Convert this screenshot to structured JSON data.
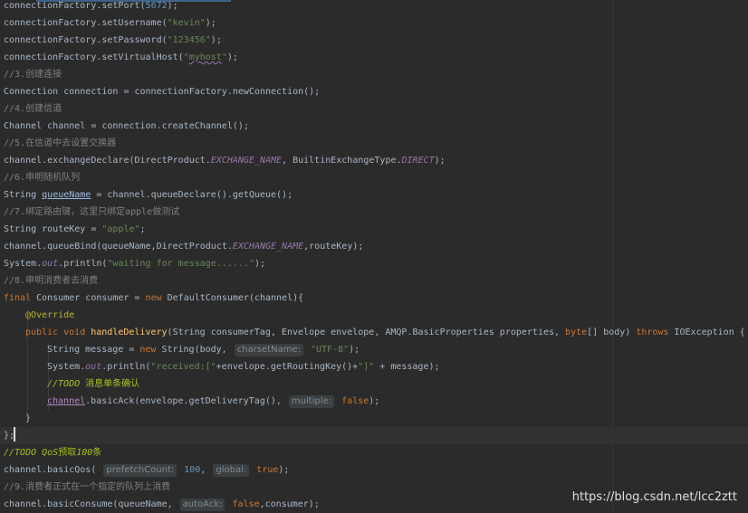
{
  "code": {
    "l1": {
      "a": "connectionFactory.setPort(",
      "n": "5672",
      "b": ");"
    },
    "l2": {
      "a": "connectionFactory.setUsername(",
      "s": "\"kevin\"",
      "b": ");"
    },
    "l3": {
      "a": "connectionFactory.setPassword(",
      "s": "\"123456\"",
      "b": ");"
    },
    "l4": {
      "a": "connectionFactory.setVirtualHost(",
      "s1": "\"",
      "sv": "myhost",
      "s2": "\"",
      "b": ");"
    },
    "l5": {
      "slashes": "//3.",
      "text": "创建连接"
    },
    "l6": {
      "a": "Connection connection = connectionFactory.newConnection();"
    },
    "l7": {
      "slashes": "//4.",
      "text": "创建信道"
    },
    "l8": {
      "a": "Channel channel = connection.createChannel();"
    },
    "l9": {
      "slashes": "//5.",
      "text": "在信道中去设置交换器"
    },
    "l10": {
      "a": "channel.exchangeDeclare(DirectProduct.",
      "sf1": "EXCHANGE_NAME",
      "b": ", BuiltinExchangeType.",
      "sf2": "DIRECT",
      "c": ");"
    },
    "l11": {
      "slashes": "//6.",
      "text": "申明随机队列"
    },
    "l12": {
      "a": "String ",
      "u": "queueName",
      "b": " = channel.queueDeclare().getQueue();"
    },
    "l13": {
      "slashes": "//7.",
      "text": "绑定路由键，这里只绑定",
      "mono": "apple",
      "text2": "做测试"
    },
    "l14": {
      "a": "String routeKey = ",
      "s": "\"apple\"",
      "b": ";"
    },
    "l15": {
      "a": "channel.queueBind(queueName,DirectProduct.",
      "sf": "EXCHANGE_NAME",
      "b": ",routeKey);"
    },
    "l16": {
      "a": "System.",
      "sf": "out",
      "b": ".println(",
      "s": "\"waiting for message......\"",
      "c": ");"
    },
    "l17": {
      "slashes": "//8.",
      "text": "申明消费者去消费"
    },
    "l18": {
      "kw1": "final ",
      "a": "Consumer consumer = ",
      "kw2": "new ",
      "b": "DefaultConsumer(channel){"
    },
    "l19": {
      "ann": "@Override"
    },
    "l20": {
      "kw1": "public void ",
      "fn": "handleDelivery",
      "a": "(String consumerTag, Envelope envelope, AMQP.BasicProperties properties, ",
      "kw2": "byte",
      "b": "[] body) ",
      "kw3": "throws ",
      "c": "IOException {"
    },
    "l21": {
      "a": "String message = ",
      "kw": "new ",
      "b": "String(body, ",
      "hint": "charsetName:",
      "s": " \"UTF-8\"",
      "c": ");"
    },
    "l22": {
      "a": "System.",
      "sf": "out",
      "b": ".println(",
      "s1": "\"received:[\"",
      "c": "+envelope.getRoutingKey()+",
      "s2": "\"]\"",
      "d": " + message);"
    },
    "l23": {
      "todo": "//TODO ",
      "text": "消息单条确认"
    },
    "l24": {
      "u": "channel",
      "a": ".basicAck(envelope.getDeliveryTag(), ",
      "hint": "multiple:",
      "kw": " false",
      "b": ");"
    },
    "l25": {
      "a": "}"
    },
    "l26": {
      "a": "};"
    },
    "l27": {
      "todo": "//TODO QoS",
      "text": "预取",
      "n": "100",
      "text2": "条"
    },
    "l28": {
      "a": "channel.basicQos( ",
      "hint1": "prefetchCount:",
      "n": " 100",
      "b": ", ",
      "hint2": "global:",
      "kw": " true",
      "c": ");"
    },
    "l29": {
      "slashes": "//9.",
      "text": "消费者正式在一个指定的队列上消费"
    },
    "l30": {
      "a": "channel.basicConsume(queueName, ",
      "hint": "autoAck:",
      "kw": " false",
      "b": ",consumer);"
    }
  },
  "watermark": "https://blog.csdn.net/lcc2ztt",
  "colors": {
    "background": "#2b2b2b",
    "keyword": "#cc7832",
    "string": "#6a8759",
    "comment": "#808080",
    "number": "#6897bb",
    "todo": "#a8c023"
  }
}
